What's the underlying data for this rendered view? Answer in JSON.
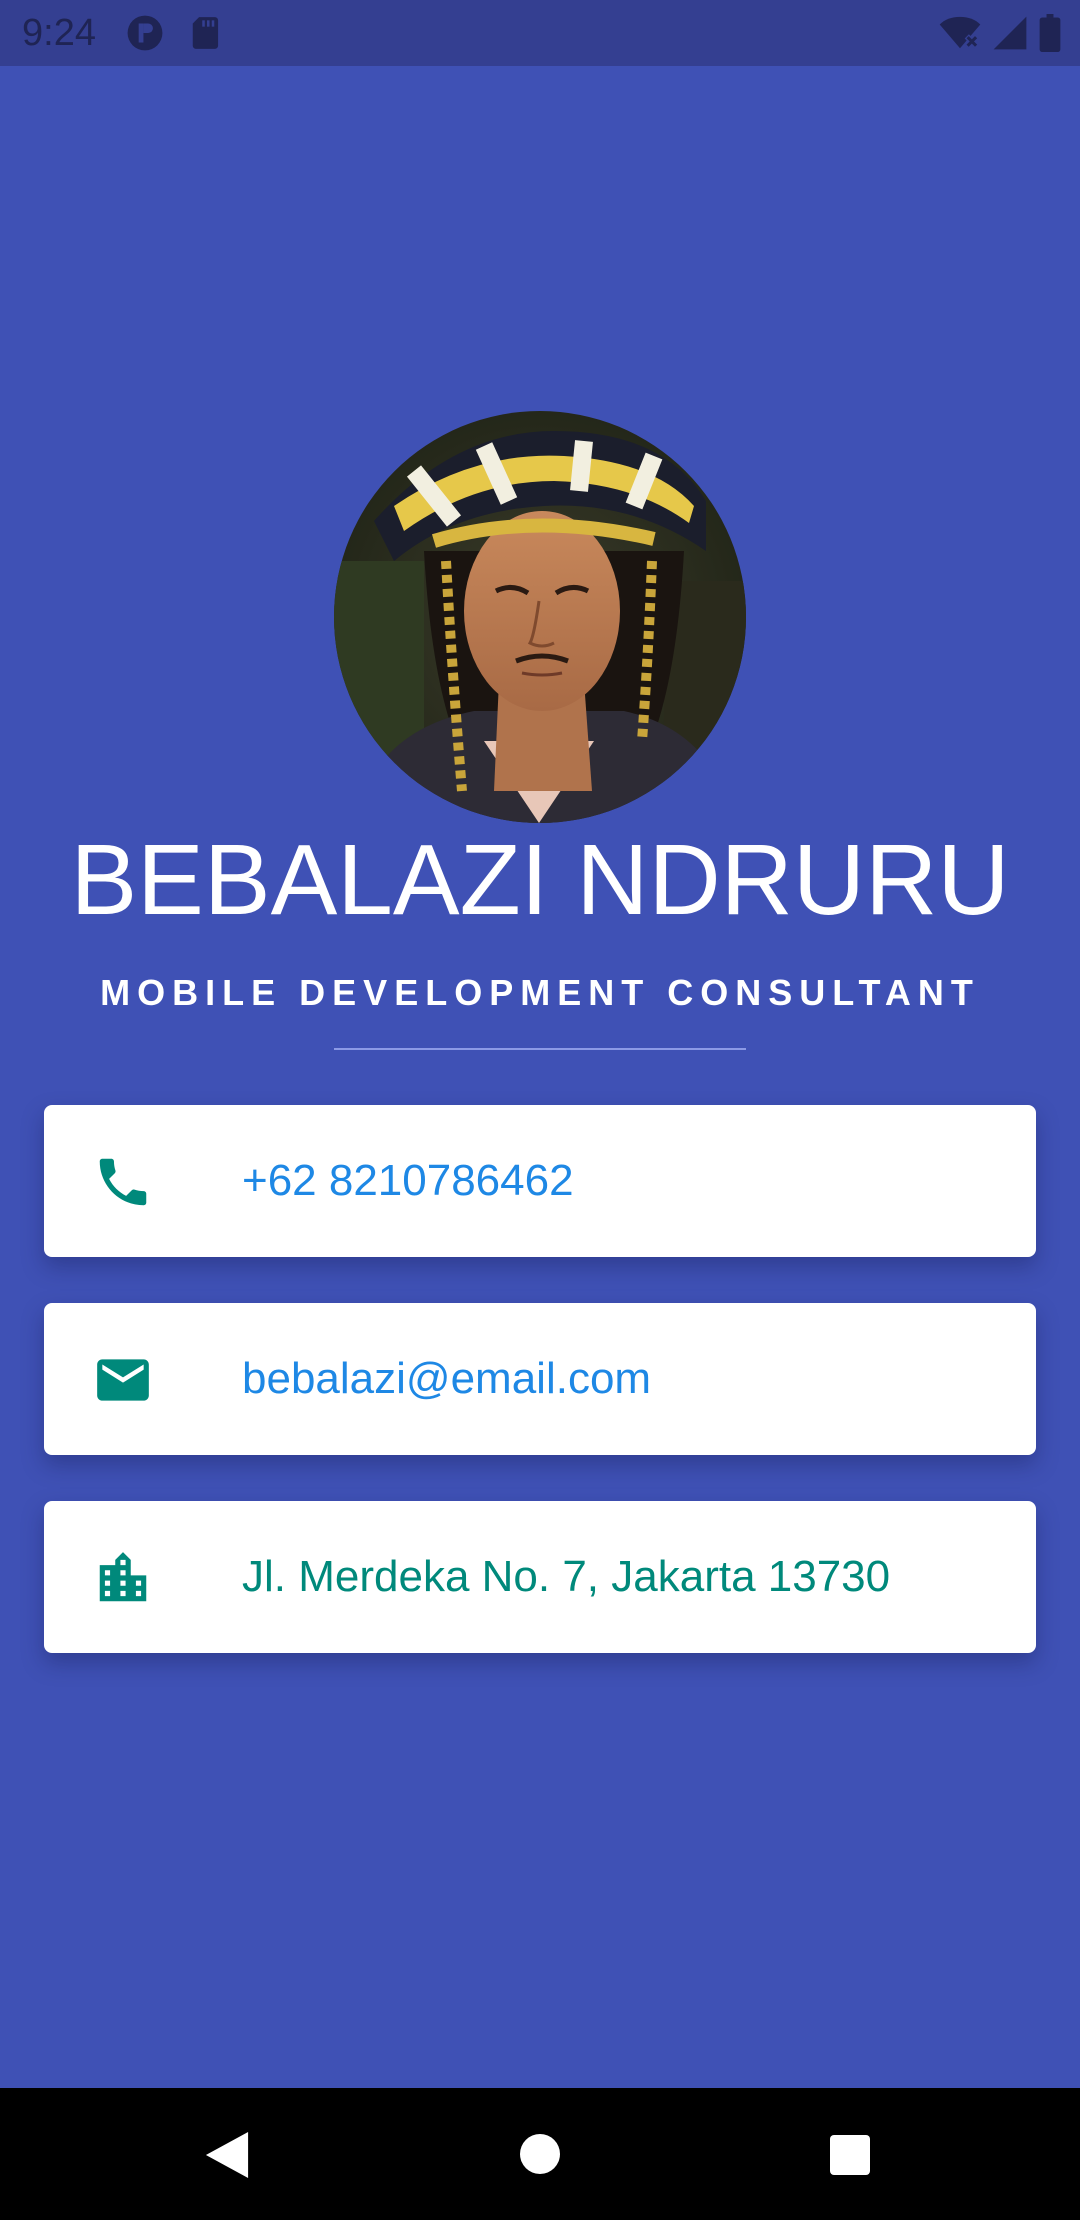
{
  "status_bar": {
    "time": "9:24",
    "left_icons": [
      "app-indicator-icon",
      "sd-card-icon"
    ],
    "right_icons": [
      "wifi-off-icon",
      "cell-signal-icon",
      "battery-icon"
    ]
  },
  "profile": {
    "avatar_icon": "profile-photo",
    "name": "BEBALAZI NDRURU",
    "title": "MOBILE DEVELOPMENT CONSULTANT"
  },
  "contacts": {
    "phone": {
      "icon": "phone-icon",
      "value": "+62 8210786462"
    },
    "email": {
      "icon": "email-icon",
      "value": "bebalazi@email.com"
    },
    "address": {
      "icon": "building-icon",
      "value": "Jl. Merdeka No. 7, Jakarta 13730"
    }
  },
  "navigation": {
    "buttons": [
      "back",
      "home",
      "recents"
    ]
  },
  "colors": {
    "background": "#3F51B5",
    "status_bar": "#343F91",
    "card": "#FFFFFF",
    "icon_teal": "#00897B",
    "link_blue": "#1E88E5",
    "divider": "#8C9AE6"
  }
}
